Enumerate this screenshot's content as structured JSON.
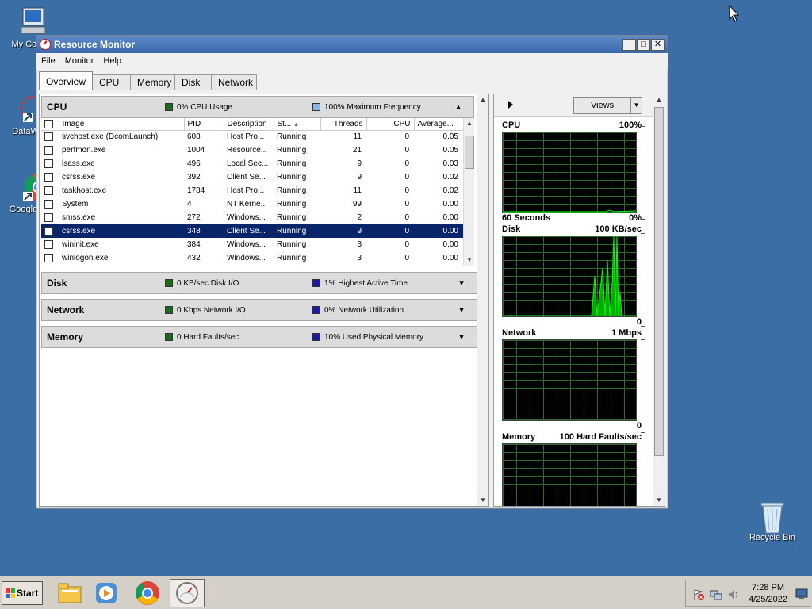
{
  "desktop": {
    "icons": [
      {
        "label": "My Com"
      },
      {
        "label": "DataWa"
      },
      {
        "label": "Google C"
      },
      {
        "label": "Recycle Bin"
      }
    ]
  },
  "window": {
    "title": "Resource Monitor",
    "title_buttons": [
      "_",
      "□",
      "✕"
    ],
    "menu": [
      "File",
      "Monitor",
      "Help"
    ],
    "tabs": [
      "Overview",
      "CPU",
      "Memory",
      "Disk",
      "Network"
    ],
    "active_tab": "Overview"
  },
  "cpu": {
    "title": "CPU",
    "metric1": "0% CPU Usage",
    "metric1_color": "#1a6b1a",
    "metric2": "100% Maximum Frequency",
    "metric2_color": "#87b6e8",
    "columns": [
      "Image",
      "PID",
      "Description",
      "St...",
      "Threads",
      "CPU",
      "Average..."
    ],
    "rows": [
      {
        "image": "svchost.exe (DcomLaunch)",
        "pid": "608",
        "desc": "Host Pro...",
        "status": "Running",
        "threads": "11",
        "cpu": "0",
        "avg": "0.05"
      },
      {
        "image": "perfmon.exe",
        "pid": "1004",
        "desc": "Resource...",
        "status": "Running",
        "threads": "21",
        "cpu": "0",
        "avg": "0.05"
      },
      {
        "image": "lsass.exe",
        "pid": "496",
        "desc": "Local Sec...",
        "status": "Running",
        "threads": "9",
        "cpu": "0",
        "avg": "0.03"
      },
      {
        "image": "csrss.exe",
        "pid": "392",
        "desc": "Client Se...",
        "status": "Running",
        "threads": "9",
        "cpu": "0",
        "avg": "0.02"
      },
      {
        "image": "taskhost.exe",
        "pid": "1784",
        "desc": "Host Pro...",
        "status": "Running",
        "threads": "11",
        "cpu": "0",
        "avg": "0.02"
      },
      {
        "image": "System",
        "pid": "4",
        "desc": "NT Kerne...",
        "status": "Running",
        "threads": "99",
        "cpu": "0",
        "avg": "0.00"
      },
      {
        "image": "smss.exe",
        "pid": "272",
        "desc": "Windows...",
        "status": "Running",
        "threads": "2",
        "cpu": "0",
        "avg": "0.00"
      },
      {
        "image": "csrss.exe",
        "pid": "348",
        "desc": "Client Se...",
        "status": "Running",
        "threads": "9",
        "cpu": "0",
        "avg": "0.00"
      },
      {
        "image": "wininit.exe",
        "pid": "384",
        "desc": "Windows...",
        "status": "Running",
        "threads": "3",
        "cpu": "0",
        "avg": "0.00"
      },
      {
        "image": "winlogon.exe",
        "pid": "432",
        "desc": "Windows...",
        "status": "Running",
        "threads": "3",
        "cpu": "0",
        "avg": "0.00"
      }
    ],
    "selected_row": 7
  },
  "disk": {
    "title": "Disk",
    "metric1": "0 KB/sec Disk I/O",
    "metric1_color": "#1a6b1a",
    "metric2": "1% Highest Active Time",
    "metric2_color": "#1a1aa6"
  },
  "network": {
    "title": "Network",
    "metric1": "0 Kbps Network I/O",
    "metric1_color": "#1a6b1a",
    "metric2": "0% Network Utilization",
    "metric2_color": "#1a1aa6"
  },
  "memory": {
    "title": "Memory",
    "metric1": "0 Hard Faults/sec",
    "metric1_color": "#1a6b1a",
    "metric2": "10% Used Physical Memory",
    "metric2_color": "#1a1aa6"
  },
  "graphs": {
    "views_label": "Views",
    "cpu": {
      "title": "CPU",
      "max": "100%",
      "foot_left": "60 Seconds",
      "foot_right": "0%"
    },
    "disk": {
      "title": "Disk",
      "max": "100 KB/sec",
      "foot_right": "0"
    },
    "network": {
      "title": "Network",
      "max": "1 Mbps",
      "foot_right": "0"
    },
    "memory": {
      "title": "Memory",
      "max": "100 Hard Faults/sec"
    }
  },
  "taskbar": {
    "start_label": "Start",
    "time": "7:28 PM",
    "date": "4/25/2022"
  }
}
